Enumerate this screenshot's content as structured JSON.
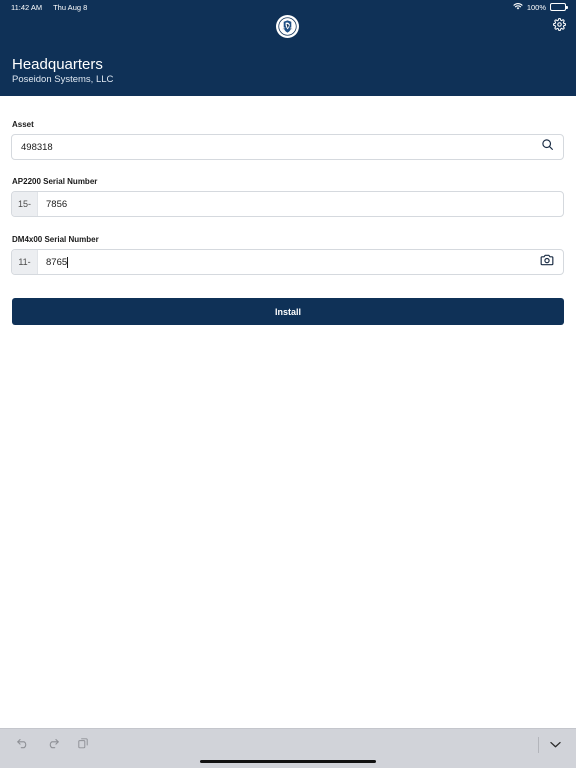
{
  "status_bar": {
    "time": "11:42 AM",
    "date": "Thu Aug 8",
    "battery": "100%",
    "battery_level": 1.0
  },
  "header": {
    "logo_icon": "shield-helmet-logo-icon",
    "settings_icon": "gear-icon",
    "title": "Headquarters",
    "subtitle": "Poseidon Systems, LLC",
    "background_color": "#0f3157"
  },
  "form": {
    "asset": {
      "label": "Asset",
      "value": "498318",
      "icon": "search-icon"
    },
    "ap2200": {
      "label": "AP2200 Serial Number",
      "prefix": "15-",
      "value": "7856"
    },
    "dm4x00": {
      "label": "DM4x00 Serial Number",
      "prefix": "11-",
      "value": "8765",
      "icon": "camera-icon"
    },
    "install_label": "Install"
  },
  "keyboard_bar": {
    "undo_icon": "undo-icon",
    "redo_icon": "redo-icon",
    "paste_icon": "paste-icon",
    "dismiss_icon": "chevron-down-icon"
  },
  "colors": {
    "accent": "#0f3157",
    "keyboard_bar": "#d1d3d9"
  }
}
